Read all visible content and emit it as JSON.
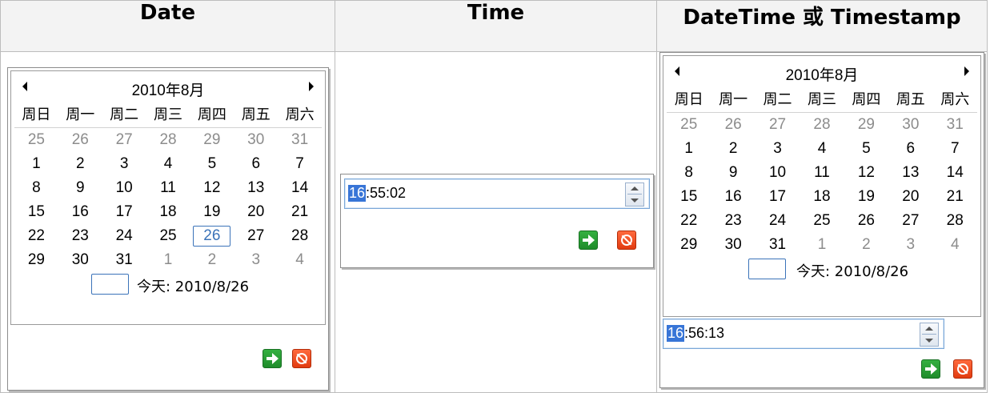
{
  "headers": [
    "Date",
    "Time",
    "DateTime 或 Timestamp"
  ],
  "weekdays": [
    "周日",
    "周一",
    "周二",
    "周三",
    "周四",
    "周五",
    "周六"
  ],
  "date_picker": {
    "title": "2010年8月",
    "today_label": "今天: 2010/8/26",
    "weeks": [
      [
        "25",
        "26",
        "27",
        "28",
        "29",
        "30",
        "31"
      ],
      [
        "1",
        "2",
        "3",
        "4",
        "5",
        "6",
        "7"
      ],
      [
        "8",
        "9",
        "10",
        "11",
        "12",
        "13",
        "14"
      ],
      [
        "15",
        "16",
        "17",
        "18",
        "19",
        "20",
        "21"
      ],
      [
        "22",
        "23",
        "24",
        "25",
        "26",
        "27",
        "28"
      ],
      [
        "29",
        "30",
        "31",
        "1",
        "2",
        "3",
        "4"
      ]
    ]
  },
  "time_picker": {
    "hours": "16",
    "rest": ":55:02"
  },
  "datetime_picker": {
    "title": "2010年8月",
    "today_label": "今天: 2010/8/26",
    "hours": "16",
    "rest": ":56:13",
    "weeks": [
      [
        "25",
        "26",
        "27",
        "28",
        "29",
        "30",
        "31"
      ],
      [
        "1",
        "2",
        "3",
        "4",
        "5",
        "6",
        "7"
      ],
      [
        "8",
        "9",
        "10",
        "11",
        "12",
        "13",
        "14"
      ],
      [
        "15",
        "16",
        "17",
        "18",
        "19",
        "20",
        "21"
      ],
      [
        "22",
        "23",
        "24",
        "25",
        "26",
        "27",
        "28"
      ],
      [
        "29",
        "30",
        "31",
        "1",
        "2",
        "3",
        "4"
      ]
    ]
  },
  "colors": {
    "selected": "#3b73b9",
    "ok": "#1e8c2a",
    "cancel": "#e23b10"
  },
  "icons": {
    "ok": "arrow-right-icon",
    "cancel": "no-entry-icon"
  }
}
